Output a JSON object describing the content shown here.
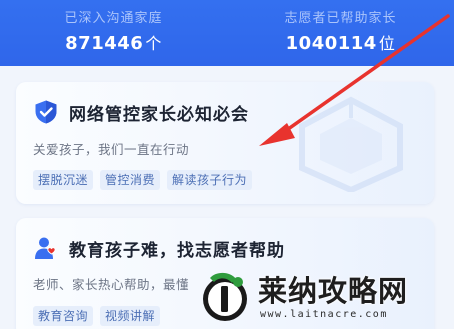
{
  "stats": [
    {
      "label": "已深入沟通家庭",
      "value": "871446",
      "unit": "个"
    },
    {
      "label": "志愿者已帮助家长",
      "value": "1040114",
      "unit": "位"
    }
  ],
  "cards": [
    {
      "title": "网络管控家长必知必会",
      "subtitle": "关爱孩子，我们一直在行动",
      "icon": "shield-check-icon",
      "tags": [
        "摆脱沉迷",
        "管控消费",
        "解读孩子行为"
      ]
    },
    {
      "title": "教育孩子难，找志愿者帮助",
      "subtitle": "老师、家长热心帮助，最懂",
      "icon": "volunteer-heart-icon",
      "tags": [
        "教育咨询",
        "视频讲解"
      ]
    }
  ],
  "watermark": {
    "title": "莱纳攻略网",
    "url": "www.laitnacre.com"
  },
  "colors": {
    "banner": "#3470f0",
    "accent": "#2f66ea",
    "arrow": "#e8332e",
    "tag_bg": "#e6eefb",
    "tag_text": "#4c6fb5"
  }
}
